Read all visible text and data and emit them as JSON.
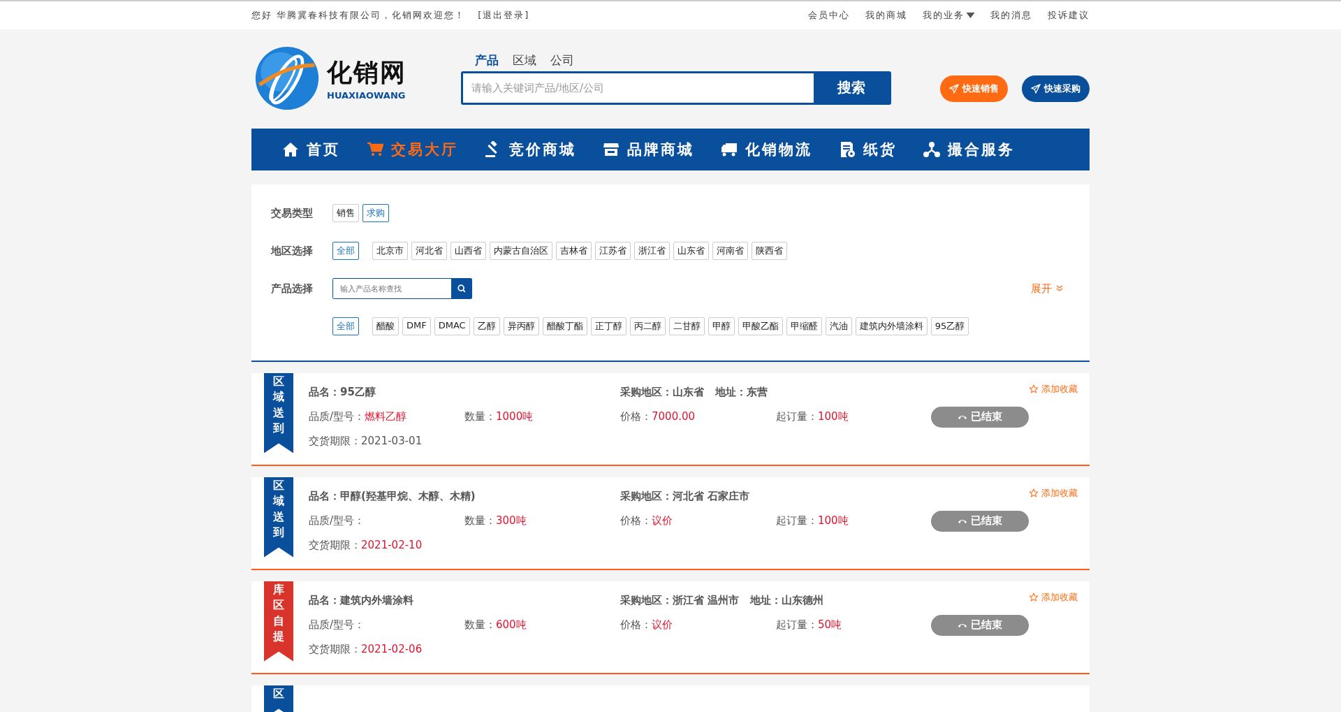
{
  "top_bar": {
    "greeting": "您好 华腾冀春科技有限公司，化销网欢迎您！",
    "logout": "[退出登录]",
    "links": [
      {
        "label": "会员中心",
        "dropdown": false
      },
      {
        "label": "我的商城",
        "dropdown": false
      },
      {
        "label": "我的业务",
        "dropdown": true
      },
      {
        "label": "我的消息",
        "dropdown": false
      },
      {
        "label": "投诉建议",
        "dropdown": false
      }
    ]
  },
  "logo": {
    "name": "化销网",
    "pinyin": "HUAXIAOWANG"
  },
  "search": {
    "tabs": [
      {
        "label": "产品",
        "selected": true
      },
      {
        "label": "区域",
        "selected": false
      },
      {
        "label": "公司",
        "selected": false
      }
    ],
    "placeholder": "请输入关键词产品/地区/公司",
    "button": "搜索"
  },
  "quick_buttons": [
    {
      "label": "快速销售",
      "color": "#ff6a13"
    },
    {
      "label": "快速采购",
      "color": "#0a4f9c"
    }
  ],
  "nav": [
    {
      "label": "首页",
      "selected": false
    },
    {
      "label": "交易大厅",
      "selected": true
    },
    {
      "label": "竞价商城",
      "selected": false
    },
    {
      "label": "品牌商城",
      "selected": false
    },
    {
      "label": "化销物流",
      "selected": false
    },
    {
      "label": "纸货",
      "selected": false
    },
    {
      "label": "撮合服务",
      "selected": false
    }
  ],
  "filters": {
    "trade_type": {
      "label": "交易类型",
      "options": [
        {
          "label": "销售",
          "selected": false
        },
        {
          "label": "求购",
          "selected": true
        }
      ]
    },
    "region": {
      "label": "地区选择",
      "options": [
        {
          "label": "全部",
          "selected": true
        },
        {
          "label": "北京市",
          "selected": false
        },
        {
          "label": "河北省",
          "selected": false
        },
        {
          "label": "山西省",
          "selected": false
        },
        {
          "label": "内蒙古自治区",
          "selected": false
        },
        {
          "label": "吉林省",
          "selected": false
        },
        {
          "label": "江苏省",
          "selected": false
        },
        {
          "label": "浙江省",
          "selected": false
        },
        {
          "label": "山东省",
          "selected": false
        },
        {
          "label": "河南省",
          "selected": false
        },
        {
          "label": "陕西省",
          "selected": false
        }
      ]
    },
    "product": {
      "label": "产品选择",
      "placeholder": "输入产品名称查找",
      "expand": "展开",
      "options": [
        {
          "label": "全部",
          "selected": true
        },
        {
          "label": "醋酸",
          "selected": false
        },
        {
          "label": "DMF",
          "selected": false
        },
        {
          "label": "DMAC",
          "selected": false
        },
        {
          "label": "乙醇",
          "selected": false
        },
        {
          "label": "异丙醇",
          "selected": false
        },
        {
          "label": "醋酸丁酯",
          "selected": false
        },
        {
          "label": "正丁醇",
          "selected": false
        },
        {
          "label": "丙二醇",
          "selected": false
        },
        {
          "label": "二甘醇",
          "selected": false
        },
        {
          "label": "甲醇",
          "selected": false
        },
        {
          "label": "甲酸乙酯",
          "selected": false
        },
        {
          "label": "甲缩醛",
          "selected": false
        },
        {
          "label": "汽油",
          "selected": false
        },
        {
          "label": "建筑内外墙涂料",
          "selected": false
        },
        {
          "label": "95乙醇",
          "selected": false
        }
      ]
    }
  },
  "listings": [
    {
      "ribbon": "区域送到",
      "color": "#0a4f9c",
      "name": "品名：95乙醇",
      "region": "采购地区：山东省",
      "address": "地址：东营",
      "quality_label": "品质/型号：",
      "quality": "燃料乙醇",
      "qty_label": "数量：",
      "qty": "1000吨",
      "price_label": "价格：",
      "price": "7000.00",
      "min_label": "起订量：",
      "min": "100吨",
      "date_label": "交货期限：",
      "date": "2021-03-01",
      "date_highlight": false,
      "favorite": "添加收藏",
      "button": "已结束",
      "disabled": true
    },
    {
      "ribbon": "区域送到",
      "color": "#0a4f9c",
      "name": "**品名：甲醇**(羟基甲烷、木醇、木精)",
      "region": "采购地区：河北省 石家庄市",
      "quality_label": "品质/型号：",
      "qty_label": "数量：",
      "qty": "300吨",
      "price_label": "价格：",
      "price": "议价",
      "min_label": "起订量：",
      "min": "100吨",
      "date_label": "交货期限：",
      "date": "2021-02-10",
      "date_highlight": true,
      "favorite": "添加收藏",
      "button": "已结束",
      "disabled": true
    },
    {
      "ribbon": "库区自提",
      "color": "#d9342b",
      "name": "品名：建筑内外墙涂料",
      "region": "采购地区：浙江省 温州市",
      "address": "地址：山东德州",
      "quality_label": "品质/型号：",
      "qty_label": "数量：",
      "qty": "600吨",
      "price_label": "价格：",
      "price": "议价",
      "min_label": "起订量：",
      "min": "50吨",
      "date_label": "交货期限：",
      "date": "2021-02-06",
      "date_highlight": true,
      "favorite": "添加收藏",
      "button": "已结束",
      "disabled": true
    },
    {
      "ribbon": "区",
      "color": "#0a4f9c"
    }
  ]
}
